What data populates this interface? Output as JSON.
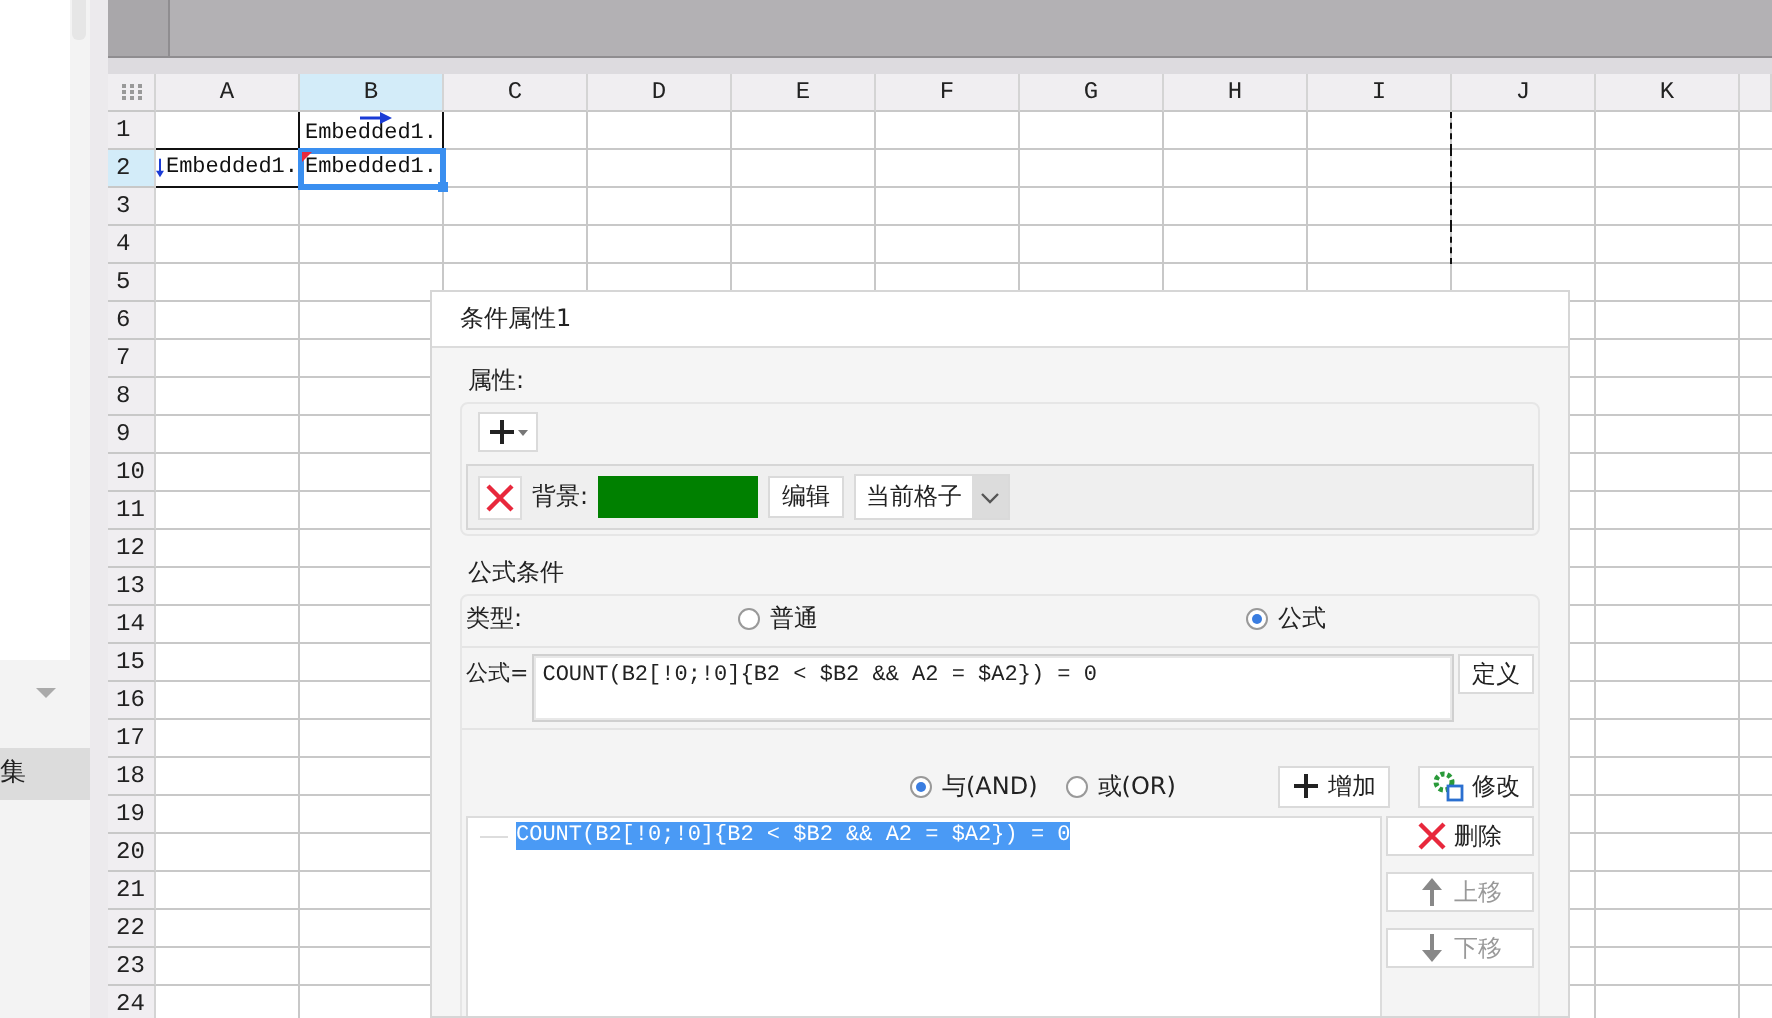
{
  "left_panel": {
    "items": [
      {
        "label": "集",
        "selected": true
      }
    ]
  },
  "sheet": {
    "columns": [
      {
        "label": "A",
        "selected": false
      },
      {
        "label": "B",
        "selected": true
      },
      {
        "label": "C",
        "selected": false
      },
      {
        "label": "D",
        "selected": false
      },
      {
        "label": "E",
        "selected": false
      },
      {
        "label": "F",
        "selected": false
      },
      {
        "label": "G",
        "selected": false
      },
      {
        "label": "H",
        "selected": false
      },
      {
        "label": "I",
        "selected": false
      },
      {
        "label": "J",
        "selected": false
      },
      {
        "label": "K",
        "selected": false
      }
    ],
    "rows": [
      {
        "label": "1",
        "selected": false,
        "cells": [
          {
            "text": "",
            "selected": false,
            "expands_down": false,
            "expands_right": false,
            "conditional": false
          },
          {
            "text": "Embedded1.",
            "selected": false,
            "expands_down": false,
            "expands_right": true,
            "conditional": false
          }
        ]
      },
      {
        "label": "2",
        "selected": true,
        "cells": [
          {
            "text": "Embedded1.",
            "selected": false,
            "expands_down": true,
            "expands_right": false,
            "conditional": false
          },
          {
            "text": "Embedded1.",
            "selected": true,
            "expands_down": false,
            "expands_right": false,
            "conditional": true
          }
        ]
      },
      {
        "label": "3",
        "selected": false,
        "cells": []
      },
      {
        "label": "4",
        "selected": false,
        "cells": []
      },
      {
        "label": "5",
        "selected": false,
        "cells": []
      },
      {
        "label": "6",
        "selected": false,
        "cells": []
      },
      {
        "label": "7",
        "selected": false,
        "cells": []
      },
      {
        "label": "8",
        "selected": false,
        "cells": []
      },
      {
        "label": "9",
        "selected": false,
        "cells": []
      },
      {
        "label": "10",
        "selected": false,
        "cells": []
      },
      {
        "label": "11",
        "selected": false,
        "cells": []
      },
      {
        "label": "12",
        "selected": false,
        "cells": []
      },
      {
        "label": "13",
        "selected": false,
        "cells": []
      },
      {
        "label": "14",
        "selected": false,
        "cells": []
      },
      {
        "label": "15",
        "selected": false,
        "cells": []
      },
      {
        "label": "16",
        "selected": false,
        "cells": []
      },
      {
        "label": "17",
        "selected": false,
        "cells": []
      },
      {
        "label": "18",
        "selected": false,
        "cells": []
      },
      {
        "label": "19",
        "selected": false,
        "cells": []
      },
      {
        "label": "20",
        "selected": false,
        "cells": []
      },
      {
        "label": "21",
        "selected": false,
        "cells": []
      },
      {
        "label": "22",
        "selected": false,
        "cells": []
      },
      {
        "label": "23",
        "selected": false,
        "cells": []
      },
      {
        "label": "24",
        "selected": false,
        "cells": []
      }
    ]
  },
  "dialog": {
    "title": "条件属性1",
    "properties": {
      "label": "属性:",
      "items": [
        {
          "label": "背景:",
          "color": "#008000",
          "edit_button": "编辑",
          "scope": "当前格子"
        }
      ]
    },
    "formula_condition": {
      "label": "公式条件",
      "type_label": "类型:",
      "types": [
        {
          "label": "普通",
          "selected": false
        },
        {
          "label": "公式",
          "selected": true
        }
      ],
      "formula_label": "公式=",
      "formula": "COUNT(B2[!0;!0]{B2 < $B2 && A2 = $A2}) = 0",
      "define_button": "定义",
      "logic": [
        {
          "label": "与(AND)",
          "selected": true
        },
        {
          "label": "或(OR)",
          "selected": false
        }
      ],
      "add_button": "增加",
      "modify_button": "修改",
      "conditions": [
        {
          "text": "COUNT(B2[!0;!0]{B2 < $B2 && A2 = $A2}) = 0",
          "selected": true
        }
      ],
      "side_buttons": [
        {
          "kind": "delete",
          "label": "删除",
          "disabled": false
        },
        {
          "kind": "up",
          "label": "上移",
          "disabled": true
        },
        {
          "kind": "down",
          "label": "下移",
          "disabled": true
        }
      ]
    }
  }
}
